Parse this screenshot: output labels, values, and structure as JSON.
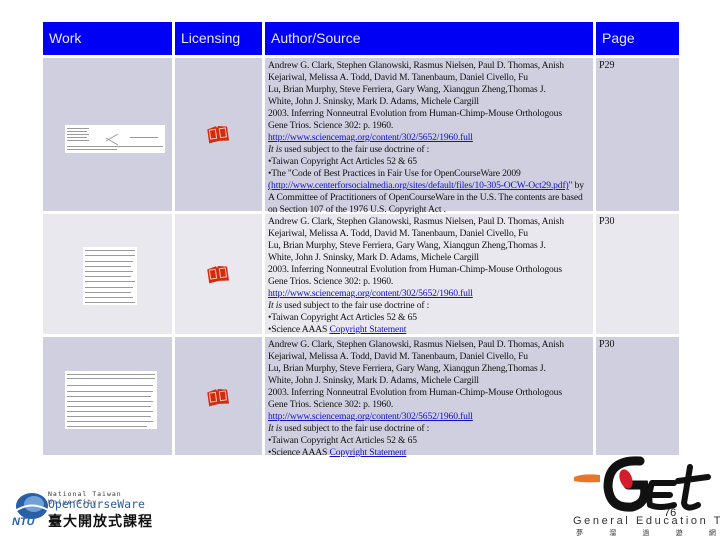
{
  "table": {
    "headers": [
      "Work",
      "Licensing",
      "Author/Source",
      "Page"
    ],
    "rows": [
      {
        "work": "table-figure-thumbnail",
        "licensing_icon": "red-book-icon",
        "author_lines": [
          "Andrew G. Clark, Stephen Glanowski, Rasmus Nielsen, Paul D. Thomas, Anish",
          "Kejariwal,  Melissa A. Todd, David M. Tanenbaum, Daniel Civello, Fu",
          "Lu, Brian Murphy, Steve Ferriera, Gary Wang, Xianqgun Zheng,Thomas J.",
          "White, John J. Sninsky, Mark D. Adams, Michele Cargill",
          "2003. Inferring Nonneutral Evolution from Human-Chimp-Mouse Orthologous",
          "Gene Trios. Science 302: p. 1960."
        ],
        "link": "http://www.sciencemag.org/content/302/5652/1960.full",
        "fair_use_italic": "It is",
        "fair_use_rest": " used subject to the fair use doctrine of :",
        "bullets": [
          "Taiwan Copyright Act Articles 52 & 65",
          "The \"Code of Best Practices in Fair Use for OpenCourseWare 2009"
        ],
        "ocw_link": "(http://www.centerforsocialmedia.org/sites/default/files/10-305-OCW-Oct29.pdf)",
        "ocw_rest": "\" by A Committee of Practitioners of OpenCourseWare in the U.S. The contents are based on Section 107 of the 1976 U.S. Copyright Act .",
        "page": "P29"
      },
      {
        "work": "table-thumbnail",
        "licensing_icon": "red-book-icon",
        "author_lines": [
          "Andrew G. Clark, Stephen Glanowski, Rasmus Nielsen, Paul D. Thomas, Anish",
          "Kejariwal,  Melissa A. Todd, David M. Tanenbaum, Daniel Civello, Fu",
          "Lu, Brian Murphy, Steve Ferriera, Gary Wang, Xianqgun Zheng,Thomas J.",
          "White, John J. Sninsky, Mark D. Adams, Michele Cargill",
          "2003. Inferring Nonneutral Evolution from Human-Chimp-Mouse Orthologous",
          "Gene Trios. Science 302: p. 1960."
        ],
        "link": "http://www.sciencemag.org/content/302/5652/1960.full",
        "fair_use_italic": "It is",
        "fair_use_rest": " used subject to the fair use doctrine of :",
        "bullet1": "Taiwan Copyright Act Articles 52 & 65",
        "bullet2_prefix": "Science AAAS ",
        "bullet2_link": "Copyright Statement",
        "page": "P30"
      },
      {
        "work": "table-thumbnail",
        "licensing_icon": "red-book-icon",
        "author_lines": [
          "Andrew G. Clark, Stephen Glanowski, Rasmus Nielsen, Paul D. Thomas, Anish",
          "Kejariwal,  Melissa A. Todd, David M. Tanenbaum, Daniel Civello, Fu",
          "Lu, Brian Murphy, Steve Ferriera, Gary Wang, Xianqgun Zheng,Thomas J.",
          "White, John J. Sninsky, Mark D. Adams, Michele Cargill",
          "2003. Inferring Nonneutral Evolution from Human-Chimp-Mouse Orthologous",
          "Gene Trios. Science 302: p. 1960."
        ],
        "link": "http://www.sciencemag.org/content/302/5652/1960.full",
        "fair_use_italic": "It is",
        "fair_use_rest": " used subject to the fair use doctrine of :",
        "bullet1": "Taiwan Copyright Act Articles 52 & 65",
        "bullet2_prefix": "Science AAAS ",
        "bullet2_link": "Copyright Statement",
        "page": "P30"
      }
    ]
  },
  "footer": {
    "ntu_logo": {
      "line1": "National Taiwan University",
      "line2": "OpenCourseWare",
      "line3": "臺大開放式課程",
      "mark": "NTU"
    },
    "get_logo": {
      "mark": "GEt",
      "line1": "General Education TW",
      "line2": "夢 溜 過 遊 網"
    },
    "page_number": "76"
  },
  "colors": {
    "header_bg": "#0000f5",
    "row_dark": "#cfcfdf",
    "row_light": "#e8e8ee",
    "link": "#1010c8",
    "book_red": "#d42a10"
  }
}
